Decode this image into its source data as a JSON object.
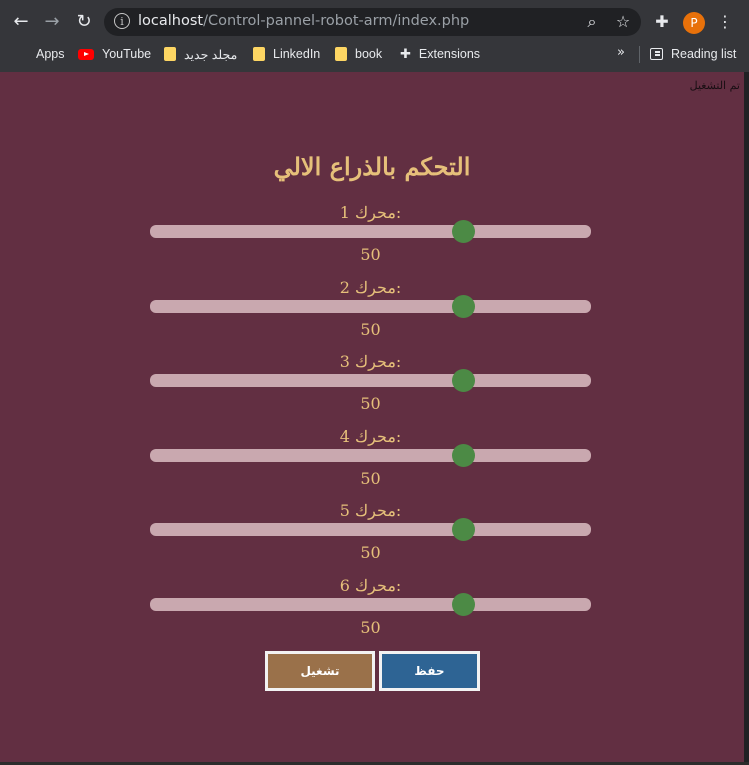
{
  "browser": {
    "url_host": "localhost",
    "url_path": "/Control-pannel-robot-arm/index.php",
    "profile_initial": "P",
    "bookmarks": [
      {
        "label": "Apps",
        "icon": "apps-grid-icon"
      },
      {
        "label": "YouTube",
        "icon": "youtube-icon"
      },
      {
        "label": "مجلد جديد",
        "icon": "folder-icon"
      },
      {
        "label": "LinkedIn",
        "icon": "folder-icon"
      },
      {
        "label": "book",
        "icon": "folder-icon"
      },
      {
        "label": "Extensions",
        "icon": "puzzle-icon"
      }
    ],
    "overflow_label": "»",
    "reading_list_label": "Reading list"
  },
  "page": {
    "status_text": "تم التشغيل",
    "title": "التحكم بالذراع الالي",
    "motors": [
      {
        "label": "محرك 1:",
        "value": "50",
        "slider_fraction": 0.71
      },
      {
        "label": "محرك 2:",
        "value": "50",
        "slider_fraction": 0.71
      },
      {
        "label": "محرك 3:",
        "value": "50",
        "slider_fraction": 0.71
      },
      {
        "label": "محرك 4:",
        "value": "50",
        "slider_fraction": 0.71
      },
      {
        "label": "محرك 5:",
        "value": "50",
        "slider_fraction": 0.71
      },
      {
        "label": "محرك 6:",
        "value": "50",
        "slider_fraction": 0.71
      }
    ],
    "run_button": "تشغيل",
    "save_button": "حفظ",
    "colors": {
      "background": "#622f42",
      "accent_text": "#e6c07a",
      "slider_track": "#c9a8af",
      "slider_thumb": "#4c8a45",
      "run_button": "#9a714a",
      "save_button": "#2e6494"
    }
  }
}
